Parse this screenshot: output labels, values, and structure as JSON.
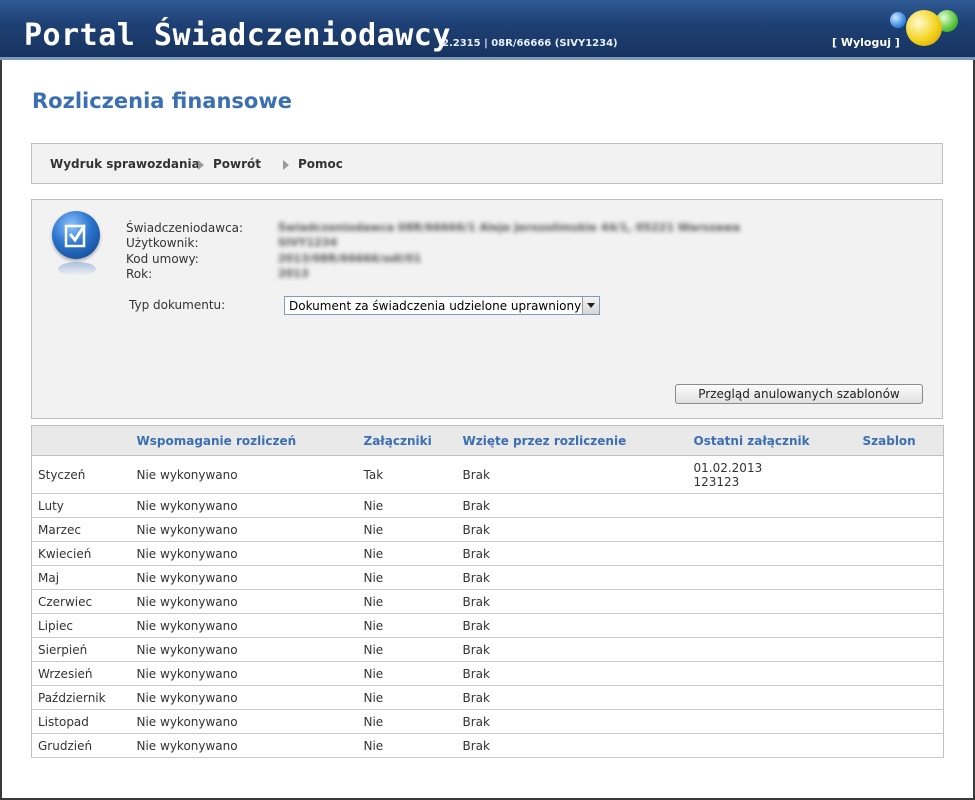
{
  "header": {
    "title": "Portal Świadczeniodawcy",
    "version": "2.2315 | 08R/66666 (SIVY1234)",
    "logout": "[ Wyloguj ]"
  },
  "page": {
    "title": "Rozliczenia finansowe"
  },
  "toolbar": {
    "items": [
      "Wydruk sprawozdania",
      "Powrót",
      "Pomoc"
    ]
  },
  "info": {
    "labels": [
      "Świadczeniodawca:",
      "Użytkownik:",
      "Kod umowy:",
      "Rok:"
    ],
    "values": [
      "Świadczeniodawca 08R/66666/1 Aleje Jerozolimskie 44/1, 05221 Warszawa",
      "SIVY1234",
      "2013/08R/66666/odl/01",
      "2013"
    ],
    "doc_type_label": "Typ dokumentu:",
    "doc_type_value": "Dokument za świadczenia udzielone uprawnionym",
    "cancelled_button": "Przegląd anulowanych szablonów"
  },
  "table": {
    "headers": [
      "",
      "Wspomaganie rozliczeń",
      "Załączniki",
      "Wzięte przez rozliczenie",
      "Ostatni załącznik",
      "Szablon"
    ],
    "rows": [
      [
        "Styczeń",
        "Nie wykonywano",
        "Tak",
        "Brak",
        "01.02.2013",
        "123123"
      ],
      [
        "Luty",
        "Nie wykonywano",
        "Nie",
        "Brak",
        "",
        ""
      ],
      [
        "Marzec",
        "Nie wykonywano",
        "Nie",
        "Brak",
        "",
        ""
      ],
      [
        "Kwiecień",
        "Nie wykonywano",
        "Nie",
        "Brak",
        "",
        ""
      ],
      [
        "Maj",
        "Nie wykonywano",
        "Nie",
        "Brak",
        "",
        ""
      ],
      [
        "Czerwiec",
        "Nie wykonywano",
        "Nie",
        "Brak",
        "",
        ""
      ],
      [
        "Lipiec",
        "Nie wykonywano",
        "Nie",
        "Brak",
        "",
        ""
      ],
      [
        "Sierpień",
        "Nie wykonywano",
        "Nie",
        "Brak",
        "",
        ""
      ],
      [
        "Wrzesień",
        "Nie wykonywano",
        "Nie",
        "Brak",
        "",
        ""
      ],
      [
        "Październik",
        "Nie wykonywano",
        "Nie",
        "Brak",
        "",
        ""
      ],
      [
        "Listopad",
        "Nie wykonywano",
        "Nie",
        "Brak",
        "",
        ""
      ],
      [
        "Grudzień",
        "Nie wykonywano",
        "Nie",
        "Brak",
        "",
        ""
      ]
    ]
  },
  "colors": {
    "header_bg": "#1d3f73",
    "title_blue": "#3b6fb2",
    "panel_bg": "#f2f2f2"
  },
  "icons": {
    "document": "document-check-icon",
    "arrow": "triangle-right-icon",
    "dropdown": "chevron-down-icon"
  }
}
